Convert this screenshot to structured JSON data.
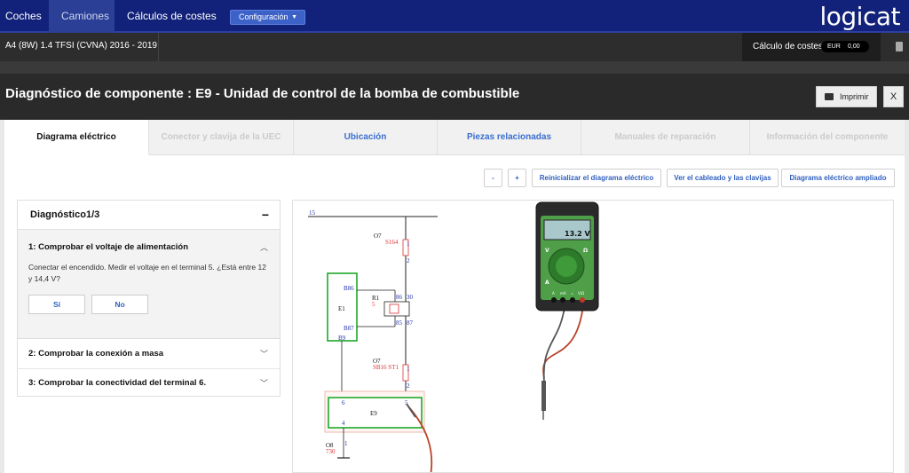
{
  "nav": {
    "items": [
      {
        "label": "Coches",
        "active": false
      },
      {
        "label": "Camiones",
        "active": true
      },
      {
        "label": "Cálculos de costes",
        "active": false
      }
    ],
    "config_label": "Configuración",
    "logo": "logicat"
  },
  "vehicle_bar": {
    "vehicle": "A4 (8W) 1.4 TFSI (CVNA) 2016 - 2019",
    "cost_label": "Cálculo de costes",
    "currency": "EUR",
    "cost_value": "0,00"
  },
  "title": {
    "text": "Diagnóstico de componente : E9 - Unidad de control de la bomba de combustible",
    "print_label": "Imprimir",
    "close_label": "X"
  },
  "tabs": [
    {
      "label": "Diagrama eléctrico",
      "state": "active"
    },
    {
      "label": "Conector y clavija de la UEC",
      "state": "disabled"
    },
    {
      "label": "Ubicación",
      "state": "link"
    },
    {
      "label": "Piezas relacionadas",
      "state": "link"
    },
    {
      "label": "Manuales de reparación",
      "state": "disabled"
    },
    {
      "label": "Información del componente",
      "state": "disabled"
    }
  ],
  "toolbar": {
    "zoom_out": "-",
    "zoom_in": "+",
    "reset": "Reinicializar el diagrama eléctrico",
    "wiring": "Ver el cableado y las clavijas",
    "extended": "Diagrama eléctrico ampliado"
  },
  "diagnostic": {
    "title": "Diagnóstico1/3",
    "collapse": "−",
    "steps": [
      {
        "title": "1: Comprobar el voltaje de alimentación",
        "expanded": true,
        "description": "Conectar el encendido. Medir el voltaje en el terminal 5. ¿Está entre 12 y 14,4 V?",
        "yes": "Sí",
        "no": "No"
      },
      {
        "title": "2: Comprobar la conexión a masa",
        "expanded": false
      },
      {
        "title": "3: Comprobar la conectividad del terminal 6.",
        "expanded": false
      }
    ]
  },
  "diagram": {
    "rail": "15",
    "labels": {
      "o7a": "O7",
      "o7a_sub": "S164",
      "o7b": "O7",
      "o7b_sub": "SB16 ST1",
      "o8": "O8",
      "o8_sub": "730",
      "e1": "E1",
      "b86": "B86",
      "b87": "B87",
      "b9": "B9",
      "r1": "R1",
      "r1_sub": "5",
      "p86": "86",
      "p30": "30",
      "p85": "85",
      "p87": "87",
      "e9": "E9",
      "e9_6": "6",
      "e9_5": "5",
      "e9_4": "4",
      "f1a": "1",
      "f2a": "2",
      "f1b": "1",
      "f2b": "2",
      "g1": "1"
    },
    "meter": {
      "reading": "13.2 V",
      "left_v": "V",
      "right_ohm": "Ω",
      "left_a": "A",
      "ports": [
        "A",
        "mA",
        "⊥",
        "V/Ω"
      ]
    }
  },
  "colors": {
    "nav_bg": "#12227a",
    "accent": "#3c62c8",
    "link": "#3a6ecf",
    "component_green": "#1fa82a",
    "meter_green": "#4f9f48",
    "probe_red": "#b9442a"
  }
}
